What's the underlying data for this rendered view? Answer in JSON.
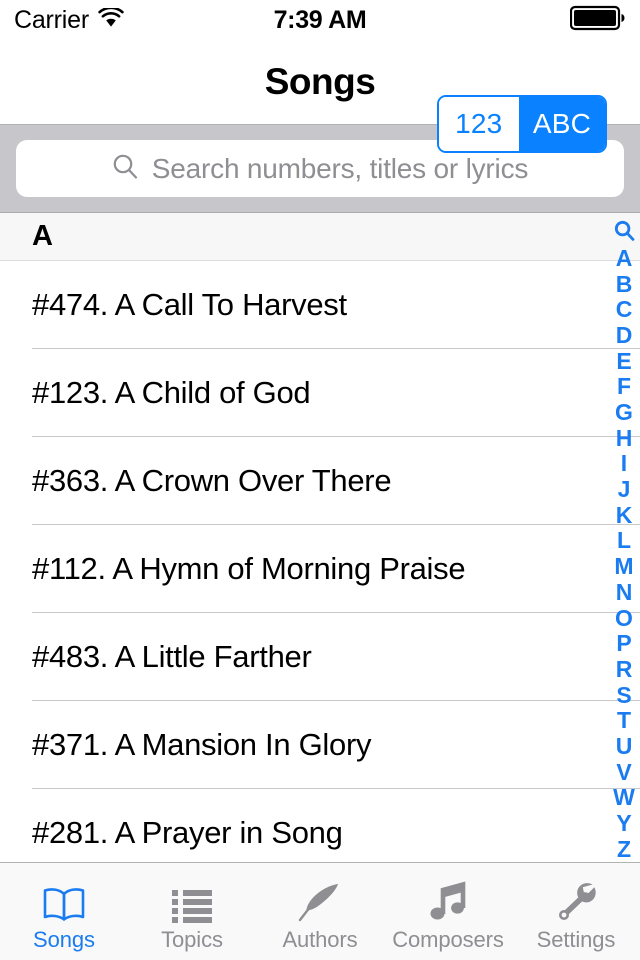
{
  "status_bar": {
    "carrier": "Carrier",
    "wifi_icon": "wifi-icon",
    "time": "7:39 AM",
    "battery_icon": "battery-full-icon"
  },
  "nav_bar": {
    "title": "Songs",
    "segmented_control": {
      "options": [
        {
          "label": "123",
          "selected": false
        },
        {
          "label": "ABC",
          "selected": true
        }
      ],
      "accent_color": "#0a82ff"
    }
  },
  "search": {
    "icon": "search-icon",
    "value": "",
    "placeholder": "Search numbers, titles or lyrics"
  },
  "list": {
    "section_header": "A",
    "rows": [
      {
        "title": "#474. A Call To Harvest"
      },
      {
        "title": "#123. A Child of God"
      },
      {
        "title": "#363. A Crown Over There"
      },
      {
        "title": "#112. A Hymn of Morning Praise"
      },
      {
        "title": "#483. A Little Farther"
      },
      {
        "title": "#371. A Mansion In Glory"
      },
      {
        "title": "#281. A Prayer in Song"
      }
    ]
  },
  "index_strip": {
    "search_icon": "search-icon",
    "letters": [
      "A",
      "B",
      "C",
      "D",
      "E",
      "F",
      "G",
      "H",
      "I",
      "J",
      "K",
      "L",
      "M",
      "N",
      "O",
      "P",
      "R",
      "S",
      "T",
      "U",
      "V",
      "W",
      "Y",
      "Z"
    ],
    "color": "#1a7cf0"
  },
  "tab_bar": {
    "active_color": "#1a7cf0",
    "inactive_color": "#8e8e93",
    "tabs": [
      {
        "label": "Songs",
        "icon": "open-book-icon",
        "active": true
      },
      {
        "label": "Topics",
        "icon": "bulleted-list-icon",
        "active": false
      },
      {
        "label": "Authors",
        "icon": "feather-quill-icon",
        "active": false
      },
      {
        "label": "Composers",
        "icon": "music-note-icon",
        "active": false
      },
      {
        "label": "Settings",
        "icon": "wrench-icon",
        "active": false
      }
    ]
  }
}
